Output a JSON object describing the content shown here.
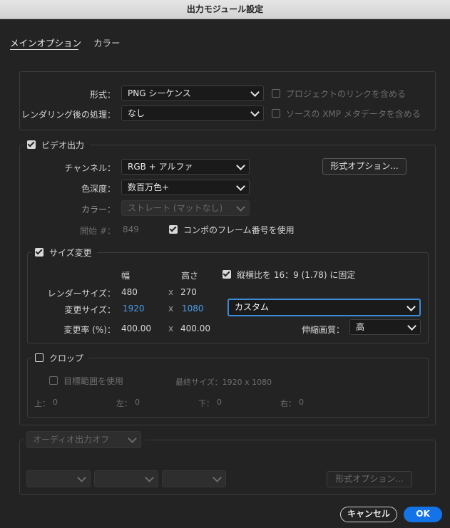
{
  "window": {
    "title": "出力モジュール設定"
  },
  "tabs": [
    {
      "label": "メインオプション"
    },
    {
      "label": "カラー"
    }
  ],
  "format": {
    "format_label": "形式：",
    "format_value": "PNG シーケンス",
    "post_label": "レンダリング後の処理：",
    "post_value": "なし",
    "link_label": "プロジェクトのリンクを含める",
    "xmp_label": "ソースの XMP メタデータを含める"
  },
  "video": {
    "heading": "ビデオ出力",
    "channel_label": "チャンネル：",
    "channel_value": "RGB + アルファ",
    "depth_label": "色深度：",
    "depth_value": "数百万色+",
    "color_label": "カラー：",
    "color_value": "ストレート (マットなし)",
    "start_label": "開始 #：",
    "start_value": "849",
    "comp_frame_label": "コンポのフレーム番号を使用",
    "format_options_button": "形式オプション..."
  },
  "resize": {
    "heading": "サイズ変更",
    "width_header": "幅",
    "height_header": "高さ",
    "lock_label": "縦横比を 16：9 (1.78) に固定",
    "render_label": "レンダーサイズ：",
    "render_w": "480",
    "render_h": "270",
    "resize_label": "変更サイズ：",
    "resize_w": "1920",
    "resize_h": "1080",
    "preset_value": "カスタム",
    "rate_label": "変更率 (%)：",
    "rate_w": "400.00",
    "rate_h": "400.00",
    "quality_label": "伸縮画質：",
    "quality_value": "高",
    "x1": "x",
    "x2": "x",
    "x3": "x"
  },
  "crop": {
    "heading": "クロップ",
    "roi_label": "目標範囲を使用",
    "final_size": "最終サイズ：1920 x 1080",
    "top_label": "上：",
    "top": "0",
    "left_label": "左：",
    "left": "0",
    "bottom_label": "下：",
    "bottom": "0",
    "right_label": "右：",
    "right": "0"
  },
  "audio": {
    "mode_value": "オーディオ出力オフ",
    "format_options_button": "形式オプション..."
  },
  "footer": {
    "cancel": "キャンセル",
    "ok": "OK"
  },
  "colors": {
    "accent": "#1473e6",
    "link_blue": "#4a9be8"
  }
}
